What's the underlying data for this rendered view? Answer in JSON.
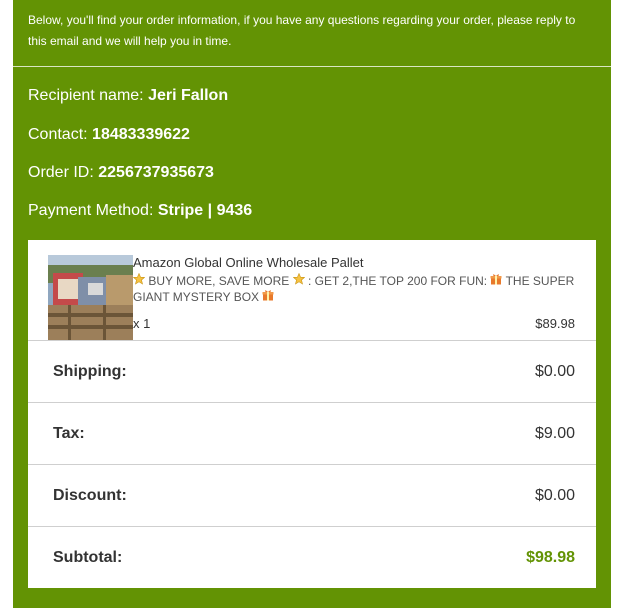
{
  "intro": "Below, you'll find your order information, if you have any questions regarding your order, please reply to this email and we will help you in time.",
  "recipient": {
    "label": "Recipient name:",
    "value": "Jeri Fallon"
  },
  "contact": {
    "label": "Contact:",
    "value": "18483339622"
  },
  "order_id": {
    "label": "Order ID:",
    "value": "2256737935673"
  },
  "payment": {
    "label": "Payment Method:",
    "value": "Stripe | 9436"
  },
  "product": {
    "name": "Amazon Global Online Wholesale Pallet",
    "variant_text_1": " BUY MORE, SAVE MORE",
    "variant_text_2": ": GET 2,THE TOP 200 FOR FUN: ",
    "variant_text_3": " THE SUPER GIANT MYSTERY BOX ",
    "star_icon": "star-icon",
    "gift_icon": "gift-icon",
    "quantity": "x 1",
    "price": "$89.98"
  },
  "summary": {
    "shipping": {
      "label": "Shipping:",
      "value": "$0.00"
    },
    "tax": {
      "label": "Tax:",
      "value": "$9.00"
    },
    "discount": {
      "label": "Discount:",
      "value": "$0.00"
    },
    "subtotal": {
      "label": "Subtotal:",
      "value": "$98.98"
    }
  },
  "colors": {
    "brand_green": "#639304",
    "divider": "#cfcfcf"
  }
}
